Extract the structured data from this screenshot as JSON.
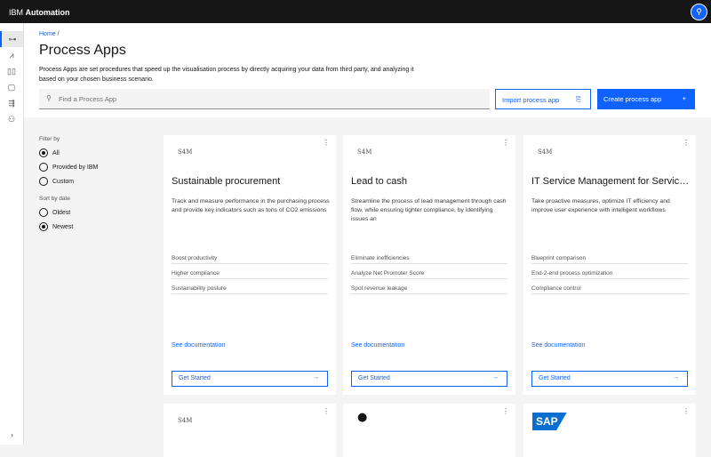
{
  "header": {
    "brand_prefix": "IBM",
    "brand_name": "Automation",
    "avatar_icon": "user-avatar-icon"
  },
  "sidebar": {
    "items": [
      "process-apps-icon",
      "analytics-icon",
      "dashboards-icon",
      "documents-icon",
      "process-flow-icon",
      "user-admin-icon"
    ],
    "expand": "›"
  },
  "breadcrumb": {
    "home": "Home",
    "sep": "/"
  },
  "page": {
    "title": "Process Apps",
    "description": "Process Apps are set procedures that speed up the visualisation process by directly acquiring your data from third party, and analyzing it based on your chosen business scenario."
  },
  "search": {
    "placeholder": "Find a Process App"
  },
  "buttons": {
    "import": "Import process app",
    "create": "Create process app",
    "create_icon": "+"
  },
  "filter": {
    "label": "Filter by",
    "options": [
      "All",
      "Provided by IBM",
      "Custom"
    ],
    "selected": "All"
  },
  "sort": {
    "label": "Sort by date",
    "options": [
      "Oldest",
      "Newest"
    ],
    "selected": "Newest"
  },
  "cards": [
    {
      "logo": "S4M",
      "title": "Sustainable procurement",
      "description": "Track and measure performance in the purchasing process and provide key indicators such as tons of CO2 emissions",
      "features": [
        "Boost productivity",
        "Higher compliance",
        "Sustainability posture"
      ],
      "doc": "See documentation",
      "cta": "Get Started"
    },
    {
      "logo": "S4M",
      "title": "Lead to cash",
      "description": "Streamline the process of lead management through cash flow, while ensuring tighter compliance, by identifying issues an",
      "features": [
        "Eliminate inefficiencies",
        "Analyze Net Promoter Score",
        "Spot revenue leakage"
      ],
      "doc": "See documentation",
      "cta": "Get Started"
    },
    {
      "logo": "S4M",
      "title": "IT Service Management for ServiceNow",
      "description": "Take proactive measures, optimize IT efficiency and improve user experience with intelligent workflows",
      "features": [
        "Blueprint comparison",
        "End-2-end process optimization",
        "Compliance control"
      ],
      "doc": "See documentation",
      "cta": "Get Started"
    }
  ],
  "cards_row2": [
    {
      "logo": "S4M"
    },
    {
      "logo": "github-icon"
    },
    {
      "logo": "SAP"
    }
  ]
}
